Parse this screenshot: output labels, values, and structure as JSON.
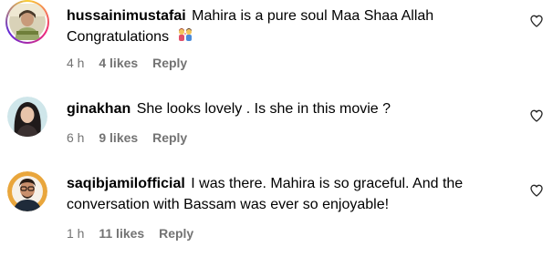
{
  "comments": [
    {
      "username": "hussainimustafai",
      "text": "Mahira is a pure soul Maa Shaa Allah Congratulations",
      "emoji": "couple-emoji",
      "time": "4 h",
      "likes": "4 likes",
      "reply": "Reply",
      "avatar": "avatar-with-story-ring"
    },
    {
      "username": "ginakhan",
      "text": "She looks lovely . Is she in this movie ?",
      "time": "6 h",
      "likes": "9 likes",
      "reply": "Reply",
      "avatar": "avatar"
    },
    {
      "username": "saqibjamilofficial",
      "text": "I was there. Mahira is so graceful. And the conversation with Bassam was ever so enjoyable!",
      "time": "1 h",
      "likes": "11 likes",
      "reply": "Reply",
      "avatar": "avatar"
    }
  ],
  "icons": {
    "like": "heart-outline-icon"
  },
  "colors": {
    "text": "#000000",
    "meta": "#737373",
    "story_ring_start": "#f9ce34",
    "story_ring_mid": "#ee2a7b",
    "story_ring_end": "#6228d7"
  }
}
